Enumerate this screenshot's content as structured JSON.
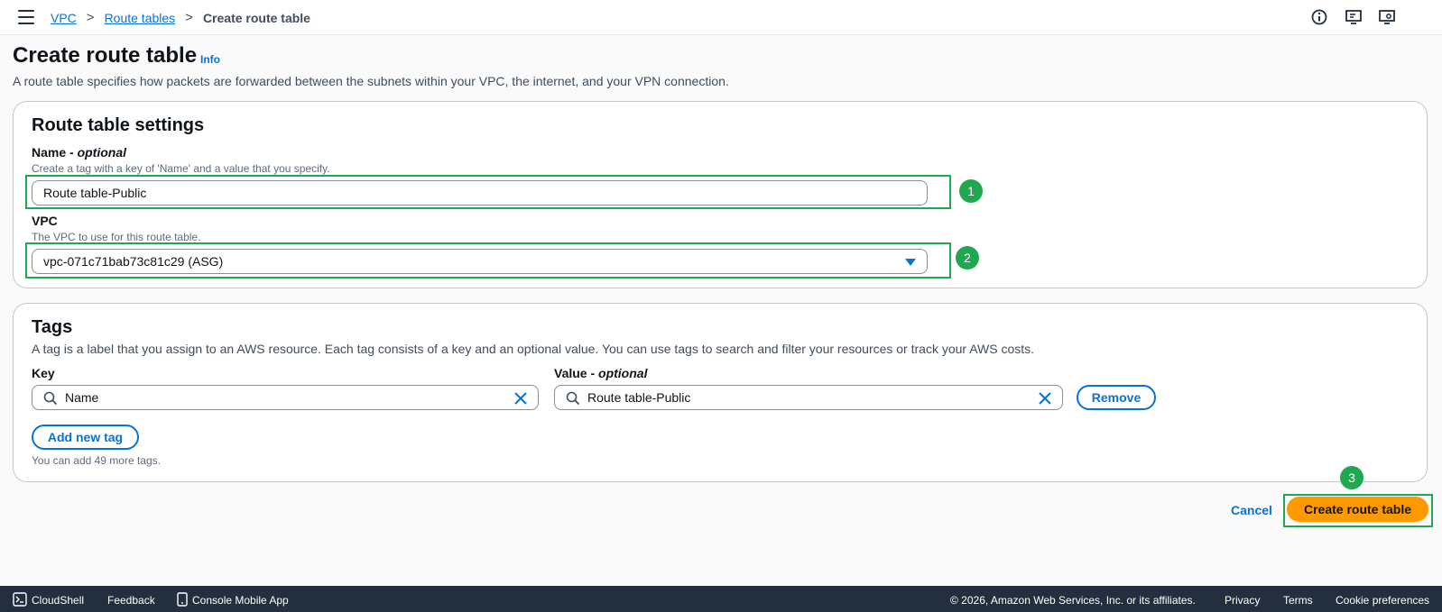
{
  "header": {
    "breadcrumbs": [
      "VPC",
      "Route tables",
      "Create route table"
    ],
    "separator": ">",
    "icons": [
      "info-circle-icon",
      "screen-feedback-icon",
      "screen-settings-icon"
    ]
  },
  "page": {
    "title": "Create route table",
    "info_label": "Info",
    "description": "A route table specifies how packets are forwarded between the subnets within your VPC, the internet, and your VPN connection."
  },
  "settings": {
    "title": "Route table settings",
    "name_label": "Name - ",
    "name_optional": "optional",
    "name_hint": "Create a tag with a key of 'Name' and a value that you specify.",
    "name_value": "Route table-Public",
    "vpc_label": "VPC",
    "vpc_hint": "The VPC to use for this route table.",
    "vpc_value": "vpc-071c71bab73c81c29 (ASG)"
  },
  "tags": {
    "title": "Tags",
    "description": "A tag is a label that you assign to an AWS resource. Each tag consists of a key and an optional value. You can use tags to search and filter your resources or track your AWS costs.",
    "key_label": "Key",
    "value_label": "Value - ",
    "value_optional": "optional",
    "key_value": "Name",
    "value_value": "Route table-Public",
    "remove_label": "Remove",
    "add_label": "Add new tag",
    "remaining_text": "You can add 49 more tags."
  },
  "actions": {
    "cancel_label": "Cancel",
    "create_label": "Create route table"
  },
  "annotations": {
    "badge1": "1",
    "badge2": "2",
    "badge3": "3",
    "highlight_color": "#1fa84f"
  },
  "footer": {
    "cloudshell": "CloudShell",
    "feedback": "Feedback",
    "mobile_app": "Console Mobile App",
    "copyright": "© 2026, Amazon Web Services, Inc. or its affiliates.",
    "privacy": "Privacy",
    "terms": "Terms",
    "cookies": "Cookie preferences"
  },
  "colors": {
    "link": "#0972d3",
    "primary_button": "#ff9900",
    "footer_bg": "#232f3e"
  }
}
